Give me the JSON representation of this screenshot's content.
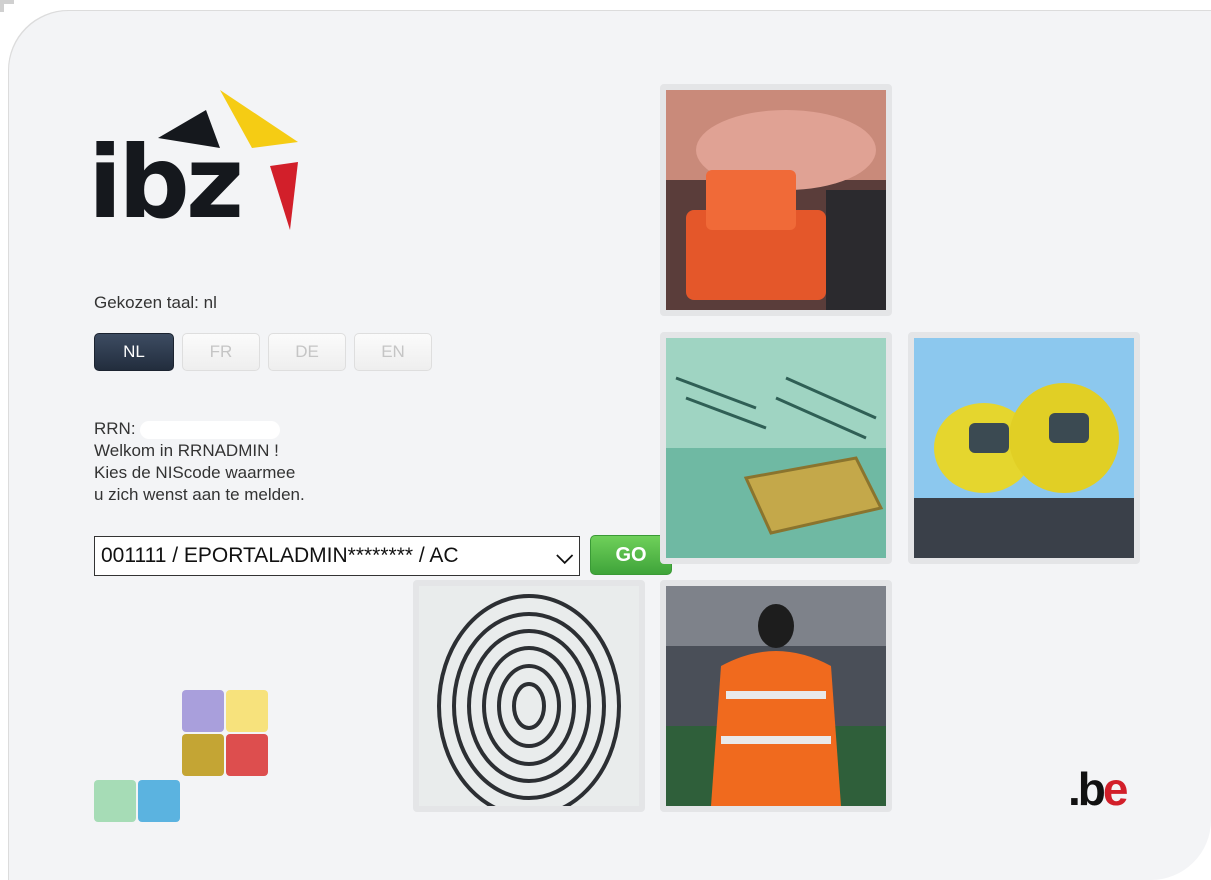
{
  "brand": {
    "logo_text": "ibz",
    "footer_logo_dot_b": ".b",
    "footer_logo_e": "e"
  },
  "language": {
    "chosen_label": "Gekozen taal: nl",
    "tabs": [
      {
        "label": "NL",
        "active": true
      },
      {
        "label": "FR",
        "active": false
      },
      {
        "label": "DE",
        "active": false
      },
      {
        "label": "EN",
        "active": false
      }
    ]
  },
  "login": {
    "rrn_label": "RRN:",
    "welcome": "Welkom in RRNADMIN !",
    "instruction_line1": "Kies de NIScode waarmee",
    "instruction_line2": "u zich wenst aan te melden.",
    "selected_niscode": "001111 / EPORTALADMIN******** / AC",
    "go_label": "GO"
  },
  "colors": {
    "accent_green": "#4fb545",
    "active_tab": "#2a3547",
    "logo_yellow": "#f5cc14",
    "logo_red": "#d21f2a",
    "logo_black": "#15181d"
  },
  "images": [
    {
      "name": "photo-id-card-reader",
      "subject": "hand pressing orange card reader"
    },
    {
      "name": "photo-eid-chip",
      "subject": "identity card chip close-up"
    },
    {
      "name": "photo-hazmat-suits",
      "subject": "workers in yellow protective suits"
    },
    {
      "name": "photo-fingerprint",
      "subject": "fingerprint"
    },
    {
      "name": "photo-steward",
      "subject": "steward in orange jacket at stadium"
    }
  ]
}
